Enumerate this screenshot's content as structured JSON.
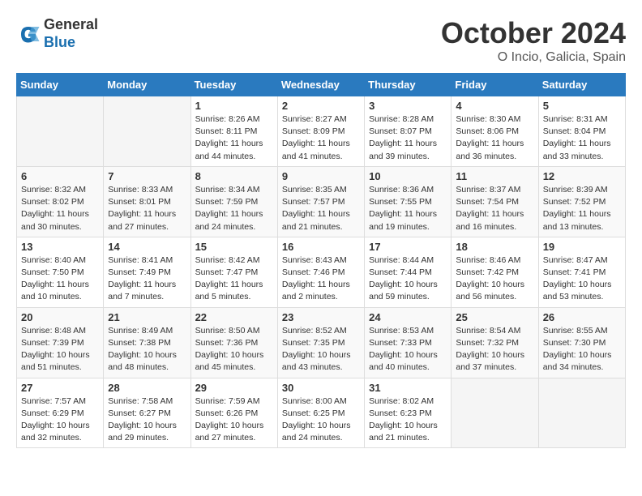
{
  "header": {
    "logo_line1": "General",
    "logo_line2": "Blue",
    "month_title": "October 2024",
    "location": "O Incio, Galicia, Spain"
  },
  "weekdays": [
    "Sunday",
    "Monday",
    "Tuesday",
    "Wednesday",
    "Thursday",
    "Friday",
    "Saturday"
  ],
  "weeks": [
    [
      {
        "day": "",
        "info": ""
      },
      {
        "day": "",
        "info": ""
      },
      {
        "day": "1",
        "info": "Sunrise: 8:26 AM\nSunset: 8:11 PM\nDaylight: 11 hours\nand 44 minutes."
      },
      {
        "day": "2",
        "info": "Sunrise: 8:27 AM\nSunset: 8:09 PM\nDaylight: 11 hours\nand 41 minutes."
      },
      {
        "day": "3",
        "info": "Sunrise: 8:28 AM\nSunset: 8:07 PM\nDaylight: 11 hours\nand 39 minutes."
      },
      {
        "day": "4",
        "info": "Sunrise: 8:30 AM\nSunset: 8:06 PM\nDaylight: 11 hours\nand 36 minutes."
      },
      {
        "day": "5",
        "info": "Sunrise: 8:31 AM\nSunset: 8:04 PM\nDaylight: 11 hours\nand 33 minutes."
      }
    ],
    [
      {
        "day": "6",
        "info": "Sunrise: 8:32 AM\nSunset: 8:02 PM\nDaylight: 11 hours\nand 30 minutes."
      },
      {
        "day": "7",
        "info": "Sunrise: 8:33 AM\nSunset: 8:01 PM\nDaylight: 11 hours\nand 27 minutes."
      },
      {
        "day": "8",
        "info": "Sunrise: 8:34 AM\nSunset: 7:59 PM\nDaylight: 11 hours\nand 24 minutes."
      },
      {
        "day": "9",
        "info": "Sunrise: 8:35 AM\nSunset: 7:57 PM\nDaylight: 11 hours\nand 21 minutes."
      },
      {
        "day": "10",
        "info": "Sunrise: 8:36 AM\nSunset: 7:55 PM\nDaylight: 11 hours\nand 19 minutes."
      },
      {
        "day": "11",
        "info": "Sunrise: 8:37 AM\nSunset: 7:54 PM\nDaylight: 11 hours\nand 16 minutes."
      },
      {
        "day": "12",
        "info": "Sunrise: 8:39 AM\nSunset: 7:52 PM\nDaylight: 11 hours\nand 13 minutes."
      }
    ],
    [
      {
        "day": "13",
        "info": "Sunrise: 8:40 AM\nSunset: 7:50 PM\nDaylight: 11 hours\nand 10 minutes."
      },
      {
        "day": "14",
        "info": "Sunrise: 8:41 AM\nSunset: 7:49 PM\nDaylight: 11 hours\nand 7 minutes."
      },
      {
        "day": "15",
        "info": "Sunrise: 8:42 AM\nSunset: 7:47 PM\nDaylight: 11 hours\nand 5 minutes."
      },
      {
        "day": "16",
        "info": "Sunrise: 8:43 AM\nSunset: 7:46 PM\nDaylight: 11 hours\nand 2 minutes."
      },
      {
        "day": "17",
        "info": "Sunrise: 8:44 AM\nSunset: 7:44 PM\nDaylight: 10 hours\nand 59 minutes."
      },
      {
        "day": "18",
        "info": "Sunrise: 8:46 AM\nSunset: 7:42 PM\nDaylight: 10 hours\nand 56 minutes."
      },
      {
        "day": "19",
        "info": "Sunrise: 8:47 AM\nSunset: 7:41 PM\nDaylight: 10 hours\nand 53 minutes."
      }
    ],
    [
      {
        "day": "20",
        "info": "Sunrise: 8:48 AM\nSunset: 7:39 PM\nDaylight: 10 hours\nand 51 minutes."
      },
      {
        "day": "21",
        "info": "Sunrise: 8:49 AM\nSunset: 7:38 PM\nDaylight: 10 hours\nand 48 minutes."
      },
      {
        "day": "22",
        "info": "Sunrise: 8:50 AM\nSunset: 7:36 PM\nDaylight: 10 hours\nand 45 minutes."
      },
      {
        "day": "23",
        "info": "Sunrise: 8:52 AM\nSunset: 7:35 PM\nDaylight: 10 hours\nand 43 minutes."
      },
      {
        "day": "24",
        "info": "Sunrise: 8:53 AM\nSunset: 7:33 PM\nDaylight: 10 hours\nand 40 minutes."
      },
      {
        "day": "25",
        "info": "Sunrise: 8:54 AM\nSunset: 7:32 PM\nDaylight: 10 hours\nand 37 minutes."
      },
      {
        "day": "26",
        "info": "Sunrise: 8:55 AM\nSunset: 7:30 PM\nDaylight: 10 hours\nand 34 minutes."
      }
    ],
    [
      {
        "day": "27",
        "info": "Sunrise: 7:57 AM\nSunset: 6:29 PM\nDaylight: 10 hours\nand 32 minutes."
      },
      {
        "day": "28",
        "info": "Sunrise: 7:58 AM\nSunset: 6:27 PM\nDaylight: 10 hours\nand 29 minutes."
      },
      {
        "day": "29",
        "info": "Sunrise: 7:59 AM\nSunset: 6:26 PM\nDaylight: 10 hours\nand 27 minutes."
      },
      {
        "day": "30",
        "info": "Sunrise: 8:00 AM\nSunset: 6:25 PM\nDaylight: 10 hours\nand 24 minutes."
      },
      {
        "day": "31",
        "info": "Sunrise: 8:02 AM\nSunset: 6:23 PM\nDaylight: 10 hours\nand 21 minutes."
      },
      {
        "day": "",
        "info": ""
      },
      {
        "day": "",
        "info": ""
      }
    ]
  ]
}
